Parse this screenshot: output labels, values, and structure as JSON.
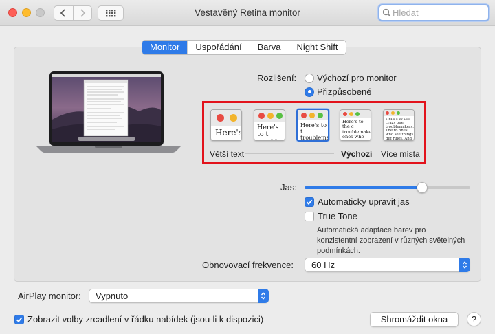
{
  "window": {
    "title": "Vestavěný Retina monitor"
  },
  "search": {
    "placeholder": "Hledat"
  },
  "tabs": [
    {
      "label": "Monitor",
      "active": true
    },
    {
      "label": "Uspořádání",
      "active": false
    },
    {
      "label": "Barva",
      "active": false
    },
    {
      "label": "Night Shift",
      "active": false
    }
  ],
  "resolution": {
    "label": "Rozlišení:",
    "options": [
      {
        "label": "Výchozí pro monitor",
        "selected": false
      },
      {
        "label": "Přizpůsobené",
        "selected": true
      }
    ],
    "scales": [
      {
        "preview_text": "Here's"
      },
      {
        "preview_text": "Here's to t troublem"
      },
      {
        "preview_text": "Here's to t troublema ones who se"
      },
      {
        "preview_text": "Here's to the c troublemakers. ones who see th rules. And they"
      },
      {
        "preview_text": "Here's to the crazy one troublemakers. The ro ones who see things diff rules. And they have no can quote them, disagr them. About the only thi"
      }
    ],
    "label_left": "Větší text",
    "label_default": "Výchozí",
    "label_right": "Více místa",
    "selected_index": 2
  },
  "brightness": {
    "label": "Jas:",
    "level": 0.71,
    "auto_label": "Automaticky upravit jas",
    "auto_checked": true
  },
  "true_tone": {
    "label": "True Tone",
    "checked": false,
    "description": "Automatická adaptace barev pro konzistentní zobrazení v různých světelných podmínkách."
  },
  "refresh": {
    "label": "Obnovovací frekvence:",
    "value": "60 Hz"
  },
  "airplay": {
    "label": "AirPlay monitor:",
    "value": "Vypnuto"
  },
  "mirror": {
    "label": "Zobrazit volby zrcadlení v řádku nabídek (jsou-li k dispozici)",
    "checked": true
  },
  "gather_button": "Shromáždit okna",
  "help_button": "?",
  "colors": {
    "accent": "#2f7be8",
    "highlight_box": "#e2131c"
  }
}
